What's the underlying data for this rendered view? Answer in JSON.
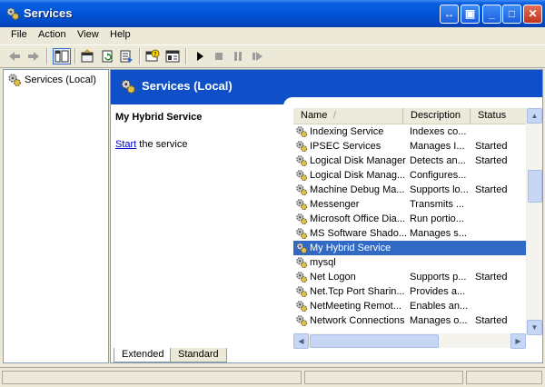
{
  "window": {
    "title": "Services"
  },
  "menu": {
    "items": [
      "File",
      "Action",
      "View",
      "Help"
    ]
  },
  "toolbar": {
    "icons": [
      "back-arrow-icon",
      "forward-arrow-icon",
      "show-tree-icon",
      "properties-icon",
      "refresh-icon",
      "export-list-icon",
      "help-icon",
      "console-icon",
      "play-icon",
      "stop-icon",
      "pause-icon",
      "restart-icon"
    ]
  },
  "tree": {
    "root": "Services (Local)"
  },
  "panel": {
    "title": "Services (Local)"
  },
  "description": {
    "service_name": "My Hybrid Service",
    "action_link": "Start",
    "action_suffix": " the service"
  },
  "table": {
    "columns": {
      "name": "Name",
      "description": "Description",
      "status": "Status",
      "sort_glyph": "/"
    },
    "rows": [
      {
        "name": "Indexing Service",
        "description": "Indexes co...",
        "status": ""
      },
      {
        "name": "IPSEC Services",
        "description": "Manages I...",
        "status": "Started"
      },
      {
        "name": "Logical Disk Manager",
        "description": "Detects an...",
        "status": "Started"
      },
      {
        "name": "Logical Disk Manag...",
        "description": "Configures...",
        "status": ""
      },
      {
        "name": "Machine Debug Ma...",
        "description": "Supports lo...",
        "status": "Started"
      },
      {
        "name": "Messenger",
        "description": "Transmits ...",
        "status": ""
      },
      {
        "name": "Microsoft Office Dia...",
        "description": "Run portio...",
        "status": ""
      },
      {
        "name": "MS Software Shado...",
        "description": "Manages s...",
        "status": ""
      },
      {
        "name": "My Hybrid Service",
        "description": "",
        "status": "",
        "selected": true
      },
      {
        "name": "mysql",
        "description": "",
        "status": ""
      },
      {
        "name": "Net Logon",
        "description": "Supports p...",
        "status": "Started"
      },
      {
        "name": "Net.Tcp Port Sharin...",
        "description": "Provides a...",
        "status": ""
      },
      {
        "name": "NetMeeting Remot...",
        "description": "Enables an...",
        "status": ""
      },
      {
        "name": "Network Connections",
        "description": "Manages o...",
        "status": "Started"
      }
    ]
  },
  "tabs": {
    "extended": "Extended",
    "standard": "Standard"
  },
  "colors": {
    "titlebar": "#0353d6",
    "band": "#0f50c8",
    "selection": "#316ac5",
    "link": "#0000cc"
  }
}
